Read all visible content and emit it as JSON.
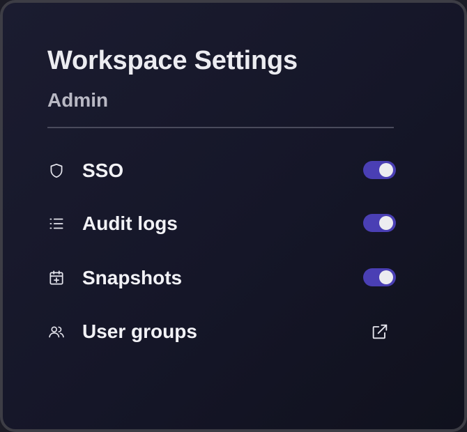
{
  "panel": {
    "title": "Workspace Settings",
    "subtitle": "Admin"
  },
  "items": [
    {
      "label": "SSO",
      "icon": "shield-icon",
      "control": "toggle",
      "enabled": true
    },
    {
      "label": "Audit logs",
      "icon": "list-icon",
      "control": "toggle",
      "enabled": true
    },
    {
      "label": "Snapshots",
      "icon": "calendar-plus-icon",
      "control": "toggle",
      "enabled": true
    },
    {
      "label": "User groups",
      "icon": "users-icon",
      "control": "external-link"
    }
  ],
  "colors": {
    "toggle_on": "#4a3fb4",
    "background": "#161728",
    "text": "#f2f2f6",
    "muted": "#b9b9c4"
  }
}
